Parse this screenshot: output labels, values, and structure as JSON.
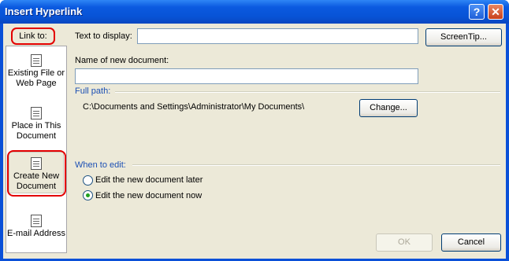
{
  "window": {
    "title": "Insert Hyperlink",
    "help_glyph": "?",
    "close_glyph": "✕"
  },
  "link_to": {
    "label": "Link to:",
    "items": [
      {
        "line1": "Existing File or",
        "line2": "Web Page"
      },
      {
        "line1": "Place in This",
        "line2": "Document"
      },
      {
        "line1": "Create New",
        "line2": "Document"
      },
      {
        "line1": "E-mail Address",
        "line2": ""
      }
    ]
  },
  "form": {
    "text_to_display_label": "Text to display:",
    "text_to_display_value": "",
    "screentip_label": "ScreenTip...",
    "name_label": "Name of new document:",
    "name_value": "",
    "full_path_label": "Full path:",
    "full_path_value": "C:\\Documents and Settings\\Administrator\\My Documents\\",
    "change_label": "Change...",
    "when_to_edit_label": "When to edit:",
    "edit_later_label": "Edit the new document later",
    "edit_now_label": "Edit the new document now",
    "selected_option": "now"
  },
  "footer": {
    "ok_label": "OK",
    "cancel_label": "Cancel"
  }
}
